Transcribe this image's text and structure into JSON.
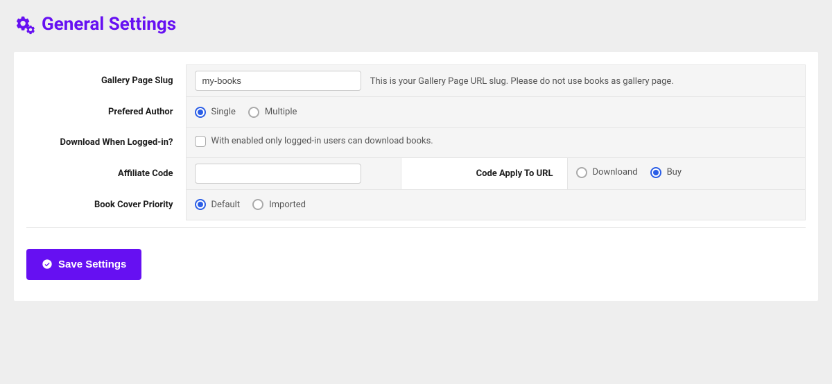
{
  "page": {
    "title": "General Settings"
  },
  "form": {
    "gallery_slug": {
      "label": "Gallery Page Slug",
      "value": "my-books",
      "helper": "This is your Gallery Page URL slug. Please do not use books as gallery page."
    },
    "preferred_author": {
      "label": "Prefered Author",
      "option_single": "Single",
      "option_multiple": "Multiple",
      "selected": "single"
    },
    "download_logged_in": {
      "label": "Download When Logged-in?",
      "helper": "With enabled only logged-in users can download books.",
      "checked": false
    },
    "affiliate_code": {
      "label": "Affiliate Code",
      "value": ""
    },
    "code_apply": {
      "label": "Code Apply To URL",
      "option_download": "Downloand",
      "option_buy": "Buy",
      "selected": "buy"
    },
    "cover_priority": {
      "label": "Book Cover Priority",
      "option_default": "Default",
      "option_imported": "Imported",
      "selected": "default"
    }
  },
  "actions": {
    "save": "Save Settings"
  }
}
